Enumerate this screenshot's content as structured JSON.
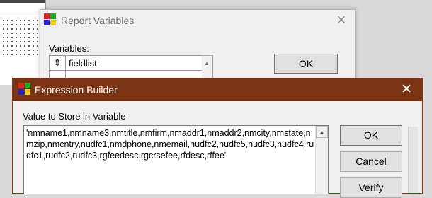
{
  "report_variables": {
    "title": "Report Variables",
    "close_glyph": "✕",
    "variables_label": "Variables:",
    "variables": [
      "fieldlist"
    ],
    "ok_label": "OK"
  },
  "expression_builder": {
    "title": "Expression Builder",
    "close_glyph": "✕",
    "value_label": "Value to Store in Variable",
    "expression": "'nmname1,nmname3,nmtitle,nmfirm,nmaddr1,nmaddr2,nmcity,nmstate,nmzip,nmcntry,nudfc1,nmdphone,nmemail,nudfc2,nudfc5,nudfc3,nudfc4,rudfc1,rudfc2,rudfc3,rgfeedesc,rgcrsefee,rfdesc,rffee'",
    "buttons": {
      "ok": "OK",
      "cancel": "Cancel",
      "verify": "Verify"
    }
  },
  "colors": {
    "eb_titlebar": "#7a3413",
    "dialog_bg": "#f0f0f0"
  },
  "icons": [
    "foxpro-app-icon",
    "close-icon",
    "sort-arrows-icon",
    "scroll-up-icon"
  ]
}
